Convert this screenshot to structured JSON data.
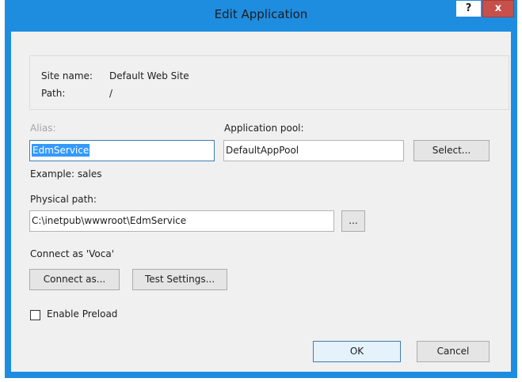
{
  "window": {
    "title": "Edit Application",
    "help_label": "?",
    "close_label": "x"
  },
  "info": {
    "site_name_label": "Site name:",
    "site_name_value": "Default Web Site",
    "path_label": "Path:",
    "path_value": "/"
  },
  "form": {
    "alias_label": "Alias:",
    "alias_value": "EdmService",
    "alias_example": "Example: sales",
    "app_pool_label": "Application pool:",
    "app_pool_value": "DefaultAppPool",
    "select_button": "Select...",
    "physical_path_label": "Physical path:",
    "physical_path_value": "C:\\inetpub\\wwwroot\\EdmService",
    "browse_button": "...",
    "connect_as_status": "Connect as 'Voca'",
    "connect_as_button": "Connect as...",
    "test_settings_button": "Test Settings...",
    "enable_preload_label": "Enable Preload",
    "enable_preload_checked": false
  },
  "footer": {
    "ok_button": "OK",
    "cancel_button": "Cancel"
  }
}
